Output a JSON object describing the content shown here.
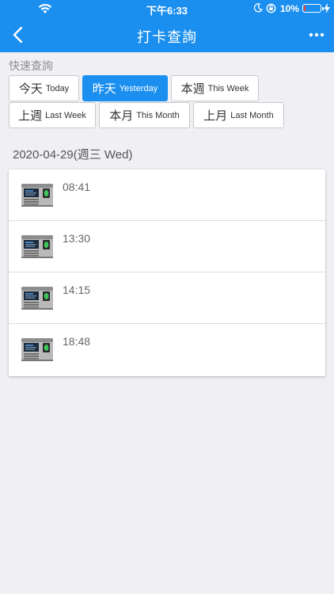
{
  "status_bar": {
    "time": "下午6:33",
    "battery_percent": "10%",
    "battery_level": 0.1,
    "icons": [
      "wifi-icon",
      "moon-icon",
      "orientation-lock-icon",
      "battery-icon",
      "charging-bolt-icon"
    ]
  },
  "nav": {
    "title": "打卡查詢",
    "back_icon": "chevron-left-icon",
    "more_icon": "ellipsis-icon"
  },
  "quick_query": {
    "label": "快速查詢",
    "buttons": [
      {
        "zh": "今天",
        "en": "Today",
        "active": false
      },
      {
        "zh": "昨天",
        "en": "Yesterday",
        "active": true
      },
      {
        "zh": "本週",
        "en": "This Week",
        "active": false
      },
      {
        "zh": "上週",
        "en": "Last Week",
        "active": false
      },
      {
        "zh": "本月",
        "en": "This Month",
        "active": false
      },
      {
        "zh": "上月",
        "en": "Last Month",
        "active": false
      }
    ]
  },
  "date_heading": "2020-04-29(週三 Wed)",
  "records": [
    {
      "time": "08:41",
      "icon": "time-clock-device-icon"
    },
    {
      "time": "13:30",
      "icon": "time-clock-device-icon"
    },
    {
      "time": "14:15",
      "icon": "time-clock-device-icon"
    },
    {
      "time": "18:48",
      "icon": "time-clock-device-icon"
    }
  ],
  "colors": {
    "primary": "#1a8ff0",
    "background": "#efeff4",
    "battery_low": "#ff3b30"
  }
}
